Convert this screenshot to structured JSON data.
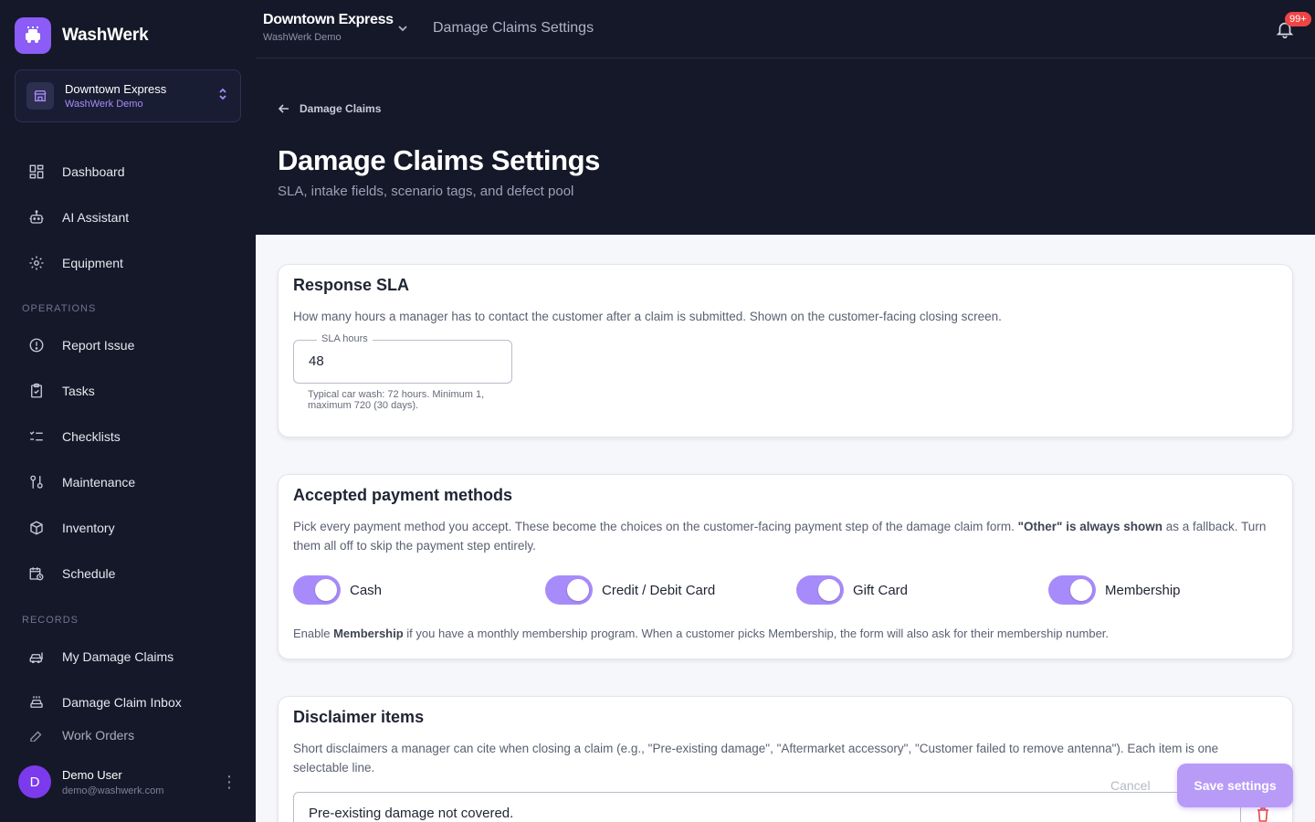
{
  "app": {
    "name": "WashWerk"
  },
  "location": {
    "name": "Downtown Express",
    "org": "WashWerk Demo"
  },
  "nav": {
    "items_top": [
      {
        "label": "Dashboard",
        "icon": "dashboard-icon"
      },
      {
        "label": "AI Assistant",
        "icon": "robot-icon"
      },
      {
        "label": "Equipment",
        "icon": "gear-icon"
      }
    ],
    "operations_label": "OPERATIONS",
    "operations": [
      {
        "label": "Report Issue",
        "icon": "alert-circle-icon"
      },
      {
        "label": "Tasks",
        "icon": "clipboard-check-icon"
      },
      {
        "label": "Checklists",
        "icon": "checklist-icon"
      },
      {
        "label": "Maintenance",
        "icon": "wrench-icon"
      },
      {
        "label": "Inventory",
        "icon": "box-icon"
      },
      {
        "label": "Schedule",
        "icon": "calendar-clock-icon"
      }
    ],
    "records_label": "RECORDS",
    "records": [
      {
        "label": "My Damage Claims",
        "icon": "car-wash-icon"
      },
      {
        "label": "Damage Claim Inbox",
        "icon": "car-inbox-icon"
      },
      {
        "label": "Work Orders",
        "icon": "tool-icon"
      }
    ]
  },
  "user": {
    "initial": "D",
    "name": "Demo User",
    "email": "demo@washwerk.com"
  },
  "topbar": {
    "title": "Damage Claims Settings",
    "badge": "99+"
  },
  "header": {
    "back_label": "Damage Claims",
    "title": "Damage Claims Settings",
    "subtitle": "SLA, intake fields, scenario tags, and defect pool"
  },
  "sla": {
    "title": "Response SLA",
    "desc": "How many hours a manager has to contact the customer after a claim is submitted. Shown on the customer-facing closing screen.",
    "field_label": "SLA hours",
    "value": "48",
    "helper": "Typical car wash: 72 hours. Minimum 1, maximum 720 (30 days)."
  },
  "payments": {
    "title": "Accepted payment methods",
    "desc_a": "Pick every payment method you accept. These become the choices on the customer-facing payment step of the damage claim form. ",
    "desc_b": "\"Other\" is always shown",
    "desc_c": " as a fallback. Turn them all off to skip the payment step entirely.",
    "methods": [
      {
        "label": "Cash",
        "enabled": true
      },
      {
        "label": "Credit / Debit Card",
        "enabled": true
      },
      {
        "label": "Gift Card",
        "enabled": true
      },
      {
        "label": "Membership",
        "enabled": true
      }
    ],
    "note_a": "Enable ",
    "note_b": "Membership",
    "note_c": " if you have a monthly membership program. When a customer picks Membership, the form will also ask for their membership number."
  },
  "disclaimers": {
    "title": "Disclaimer items",
    "desc": "Short disclaimers a manager can cite when closing a claim (e.g., \"Pre-existing damage\", \"Aftermarket accessory\", \"Customer failed to remove antenna\"). Each item is one selectable line.",
    "items": [
      "Pre-existing damage not covered."
    ]
  },
  "actions": {
    "cancel": "Cancel",
    "save": "Save settings"
  },
  "colors": {
    "accent": "#8b5cf6",
    "sidebar_bg": "#141828",
    "toggle_on": "#a78bfa",
    "badge": "#ef4444"
  }
}
